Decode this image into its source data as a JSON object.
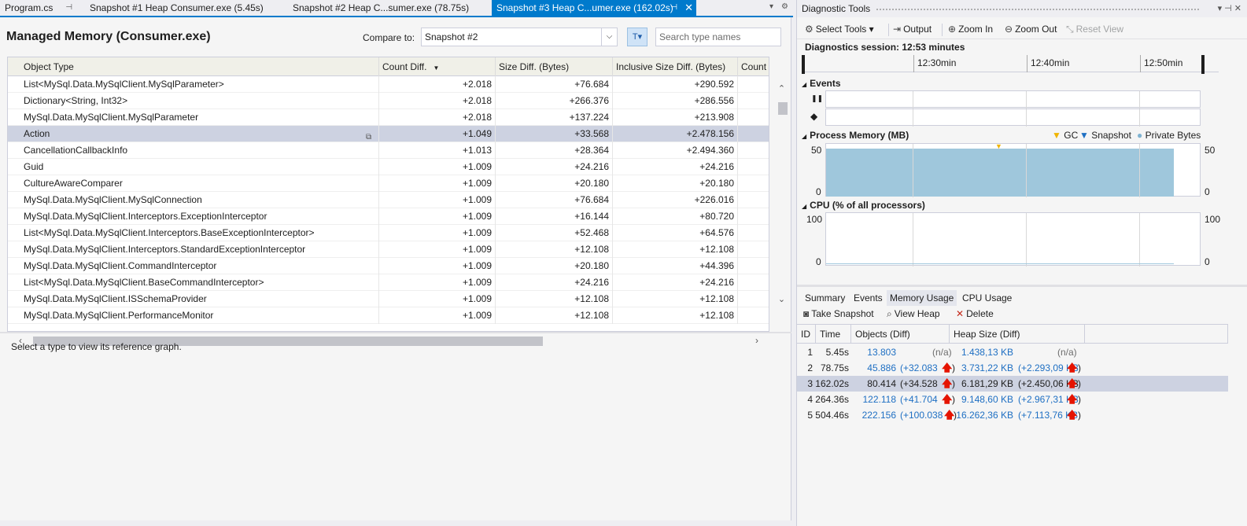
{
  "tabs": [
    {
      "label": "Program.cs",
      "pin": "⊣",
      "active": false
    },
    {
      "label": "Snapshot #1 Heap Consumer.exe (5.45s)",
      "active": false
    },
    {
      "label": "Snapshot #2 Heap C...sumer.exe (78.75s)",
      "active": false
    },
    {
      "label": "Snapshot #3 Heap C...umer.exe (162.02s)",
      "pin": "⊣",
      "close": "✕",
      "active": true
    }
  ],
  "well_controls": {
    "dropdown": "▾",
    "settings": "⚙"
  },
  "managed_memory": {
    "title": "Managed Memory (Consumer.exe)",
    "compare_label": "Compare to:",
    "compare_value": "Snapshot #2",
    "search_placeholder": "Search type names",
    "ref_hint": "Select a type to view its reference graph."
  },
  "grid": {
    "columns": [
      "Object Type",
      "Count Diff.",
      "Size Diff. (Bytes)",
      "Inclusive Size Diff. (Bytes)",
      "Count"
    ],
    "sort_indicator": "▼",
    "rows": [
      {
        "type": "List<MySql.Data.MySqlClient.MySqlParameter>",
        "count_diff": "+2.018",
        "size_diff": "+76.684",
        "incl_diff": "+290.592"
      },
      {
        "type": "Dictionary<String, Int32>",
        "count_diff": "+2.018",
        "size_diff": "+266.376",
        "incl_diff": "+286.556"
      },
      {
        "type": "MySql.Data.MySqlClient.MySqlParameter",
        "count_diff": "+2.018",
        "size_diff": "+137.224",
        "incl_diff": "+213.908"
      },
      {
        "type": "Action",
        "count_diff": "+1.049",
        "size_diff": "+33.568",
        "incl_diff": "+2.478.156",
        "selected": true
      },
      {
        "type": "CancellationCallbackInfo",
        "count_diff": "+1.013",
        "size_diff": "+28.364",
        "incl_diff": "+2.494.360"
      },
      {
        "type": "Guid",
        "count_diff": "+1.009",
        "size_diff": "+24.216",
        "incl_diff": "+24.216"
      },
      {
        "type": "CultureAwareComparer",
        "count_diff": "+1.009",
        "size_diff": "+20.180",
        "incl_diff": "+20.180"
      },
      {
        "type": "MySql.Data.MySqlClient.MySqlConnection",
        "count_diff": "+1.009",
        "size_diff": "+76.684",
        "incl_diff": "+226.016"
      },
      {
        "type": "MySql.Data.MySqlClient.Interceptors.ExceptionInterceptor",
        "count_diff": "+1.009",
        "size_diff": "+16.144",
        "incl_diff": "+80.720"
      },
      {
        "type": "List<MySql.Data.MySqlClient.Interceptors.BaseExceptionInterceptor>",
        "count_diff": "+1.009",
        "size_diff": "+52.468",
        "incl_diff": "+64.576"
      },
      {
        "type": "MySql.Data.MySqlClient.Interceptors.StandardExceptionInterceptor",
        "count_diff": "+1.009",
        "size_diff": "+12.108",
        "incl_diff": "+12.108"
      },
      {
        "type": "MySql.Data.MySqlClient.CommandInterceptor",
        "count_diff": "+1.009",
        "size_diff": "+20.180",
        "incl_diff": "+44.396"
      },
      {
        "type": "List<MySql.Data.MySqlClient.BaseCommandInterceptor>",
        "count_diff": "+1.009",
        "size_diff": "+24.216",
        "incl_diff": "+24.216"
      },
      {
        "type": "MySql.Data.MySqlClient.ISSchemaProvider",
        "count_diff": "+1.009",
        "size_diff": "+12.108",
        "incl_diff": "+12.108"
      },
      {
        "type": "MySql.Data.MySqlClient.PerformanceMonitor",
        "count_diff": "+1.009",
        "size_diff": "+12.108",
        "incl_diff": "+12.108"
      }
    ]
  },
  "diag": {
    "title": "Diagnostic Tools",
    "title_controls": "▾ ⊣ ✕",
    "toolbar": {
      "select_tools": "Select Tools",
      "select_tools_arrow": "▾",
      "output": "Output",
      "zoom_in": "Zoom In",
      "zoom_out": "Zoom Out",
      "reset_view": "Reset View"
    },
    "session": "Diagnostics session: 12:53 minutes",
    "ruler_labels": [
      "12:30min",
      "12:40min",
      "12:50min"
    ],
    "events_label": "Events",
    "pause_glyph": "❚❚",
    "diamond_glyph": "◆",
    "process_memory_label": "Process Memory (MB)",
    "legend": {
      "gc": "GC",
      "snapshot": "Snapshot",
      "private_bytes": "Private Bytes"
    },
    "mem_axis": {
      "top": "50",
      "bottom": "0"
    },
    "cpu_label": "CPU (% of all processors)",
    "cpu_axis": {
      "top": "100",
      "bottom": "0"
    },
    "bottom_tabs": [
      "Summary",
      "Events",
      "Memory Usage",
      "CPU Usage"
    ],
    "mu_toolbar": {
      "take_snapshot": "Take Snapshot",
      "view_heap": "View Heap",
      "delete": "Delete"
    },
    "snap_columns": [
      "ID",
      "Time",
      "Objects (Diff)",
      "Heap Size (Diff)"
    ],
    "snapshots": [
      {
        "id": "1",
        "time": "5.45s",
        "objects": "13.803",
        "objects_diff": "(n/a)",
        "heap": "1.438,13 KB",
        "heap_diff": "(n/a)",
        "up": false
      },
      {
        "id": "2",
        "time": "78.75s",
        "objects": "45.886",
        "objects_diff": "(+32.083",
        "heap": "3.731,22 KB",
        "heap_diff": "(+2.293,09 KB",
        "up": true
      },
      {
        "id": "3",
        "time": "162.02s",
        "objects": "80.414",
        "objects_diff": "(+34.528",
        "heap": "6.181,29 KB",
        "heap_diff": "(+2.450,06 KB",
        "up": true,
        "selected": true
      },
      {
        "id": "4",
        "time": "264.36s",
        "objects": "122.118",
        "objects_diff": "(+41.704",
        "heap": "9.148,60 KB",
        "heap_diff": "(+2.967,31 KB",
        "up": true
      },
      {
        "id": "5",
        "time": "504.46s",
        "objects": "222.156",
        "objects_diff": "(+100.038",
        "heap": "16.262,36 KB",
        "heap_diff": "(+7.113,76 KB",
        "up": true
      }
    ],
    "up_arrow": "🡅",
    "close_paren": ")"
  },
  "colors": {
    "accent": "#007acc",
    "selection": "#cdd2e1",
    "memory_fill": "#9fc7dc",
    "gc_marker": "#f0b400",
    "snapshot_marker": "#1e6fc3",
    "up_arrow": "#e51400",
    "link": "#1e6fc3"
  }
}
